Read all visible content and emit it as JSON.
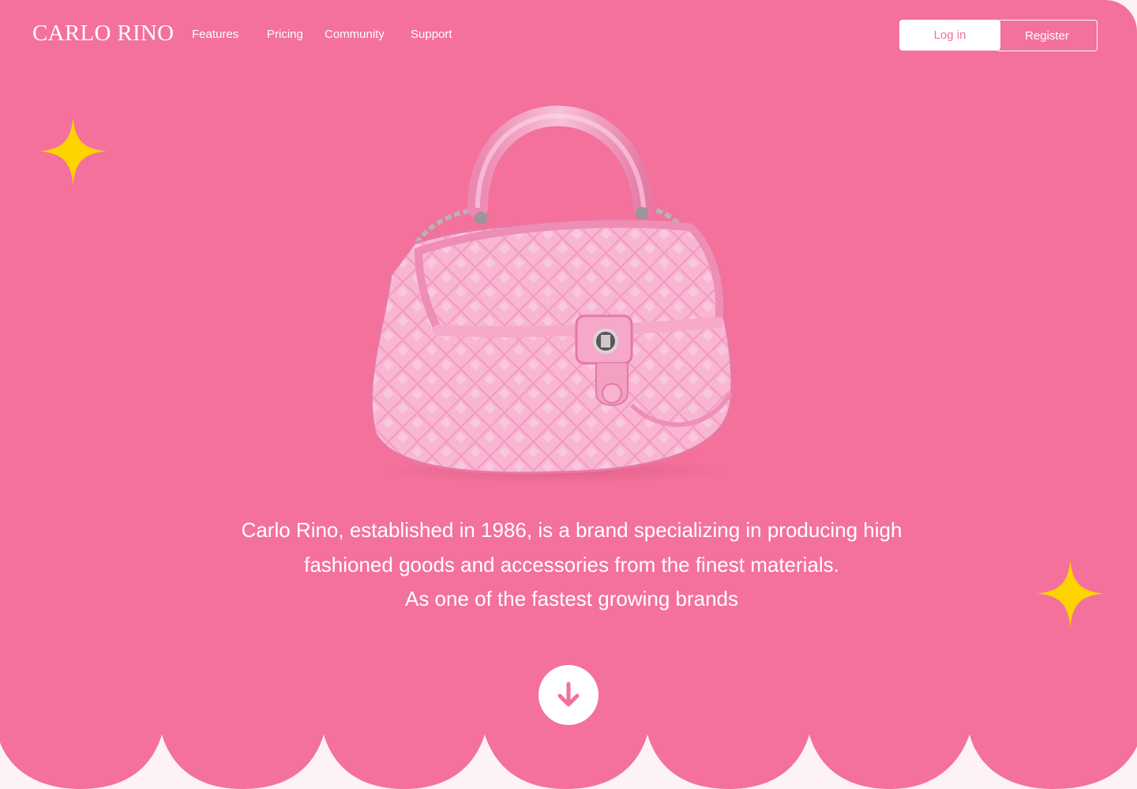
{
  "brand": {
    "logo": "CARLO RINO"
  },
  "nav": {
    "links": [
      {
        "label": "Features"
      },
      {
        "label": "Pricing"
      },
      {
        "label": "Community"
      },
      {
        "label": "Support"
      }
    ],
    "login_label": "Log in",
    "register_label": "Register"
  },
  "hero": {
    "tagline_lines": [
      "Carlo Rino, established in 1986, is a brand specializing in producing high",
      "fashioned goods and accessories from the finest materials.",
      "As one of the fastest growing brands"
    ],
    "product_image": "pink-quilted-handbag",
    "scroll_icon": "arrow-down-icon",
    "decor_icon": "sparkle-star-icon"
  },
  "colors": {
    "background": "#f3719b",
    "star": "#fdd300",
    "text": "#ffffff",
    "page_bottom": "#fdf2f4"
  }
}
